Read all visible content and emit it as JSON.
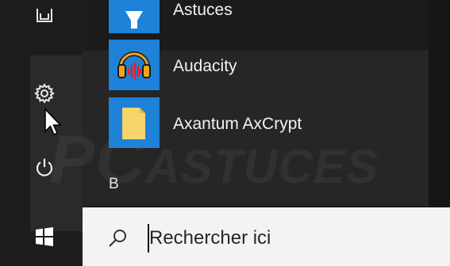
{
  "start_menu": {
    "apps": [
      {
        "label": "Astuces",
        "icon": "funnel-tile-icon"
      },
      {
        "label": "Audacity",
        "icon": "audacity-icon"
      },
      {
        "label": "Axantum AxCrypt",
        "icon": "axcrypt-folder-icon"
      }
    ],
    "group_letter": "B",
    "rail_icons": [
      "documents-icon",
      "settings-gear-icon",
      "power-icon",
      "windows-start-icon"
    ]
  },
  "watermark": {
    "part1": "PC",
    "part2": "ASTUCES"
  },
  "search": {
    "placeholder": "Rechercher ici",
    "icon": "search-icon"
  },
  "colors": {
    "tile_blue": "#1e82d8",
    "background": "#1b1b1b",
    "search_bg": "#f3f3f3"
  }
}
